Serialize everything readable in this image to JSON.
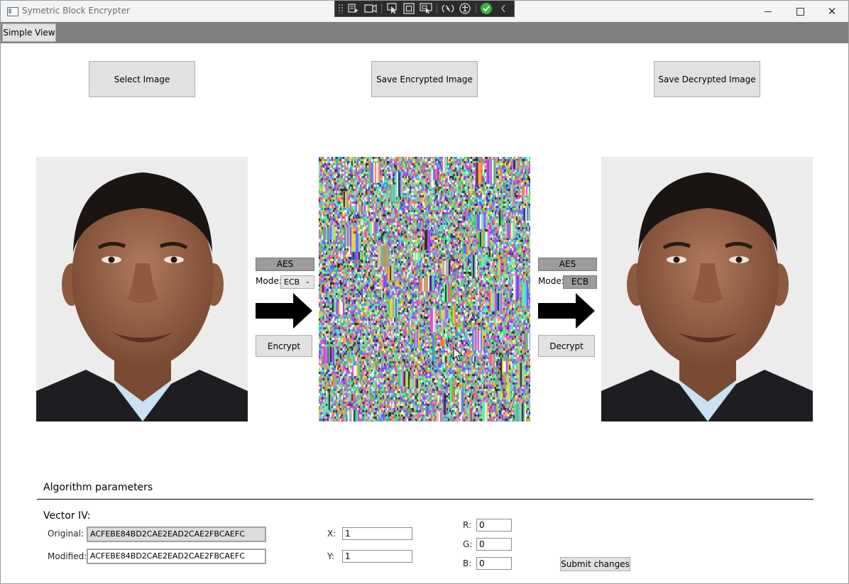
{
  "window": {
    "title": "Symetric Block Encrypter"
  },
  "menu": {
    "tab_label": "Simple View"
  },
  "toolbar": {
    "select_image": "Select Image",
    "save_encrypted": "Save Encrypted Image",
    "save_decrypted": "Save Decrypted Image"
  },
  "encrypt_panel": {
    "algorithm": "AES",
    "mode_label": "Mode:",
    "mode_value": "ECB",
    "button": "Encrypt"
  },
  "decrypt_panel": {
    "algorithm": "AES",
    "mode_label": "Mode:",
    "mode_value": "ECB",
    "button": "Decrypt"
  },
  "params": {
    "section_title": "Algorithm parameters",
    "vector_title": "Vector IV:",
    "original_label": "Original:",
    "original_value": "ACFEBE84BD2CAE2EAD2CAE2FBCAEFC",
    "modified_label": "Modified:",
    "modified_value": "ACFEBE84BD2CAE2EAD2CAE2FBCAEFC",
    "x_label": "X:",
    "x_value": "1",
    "y_label": "Y:",
    "y_value": "1",
    "r_label": "R:",
    "r_value": "0",
    "g_label": "G:",
    "g_value": "0",
    "b_label": "B:",
    "b_value": "0",
    "submit": "Submit changes"
  },
  "colors": {
    "menubar": "#808080",
    "button_face": "#e1e1e1",
    "algorithm_label": "#9c9c9c",
    "success_check": "#3cb043"
  },
  "icons": {
    "debug_toolbar": [
      "select-element-icon",
      "record-icon",
      "pointer-icon",
      "layout-adorner-icon",
      "track-focus-icon",
      "hot-reload-icon",
      "accessibility-icon",
      "binding-ok-icon",
      "collapse-icon"
    ]
  }
}
